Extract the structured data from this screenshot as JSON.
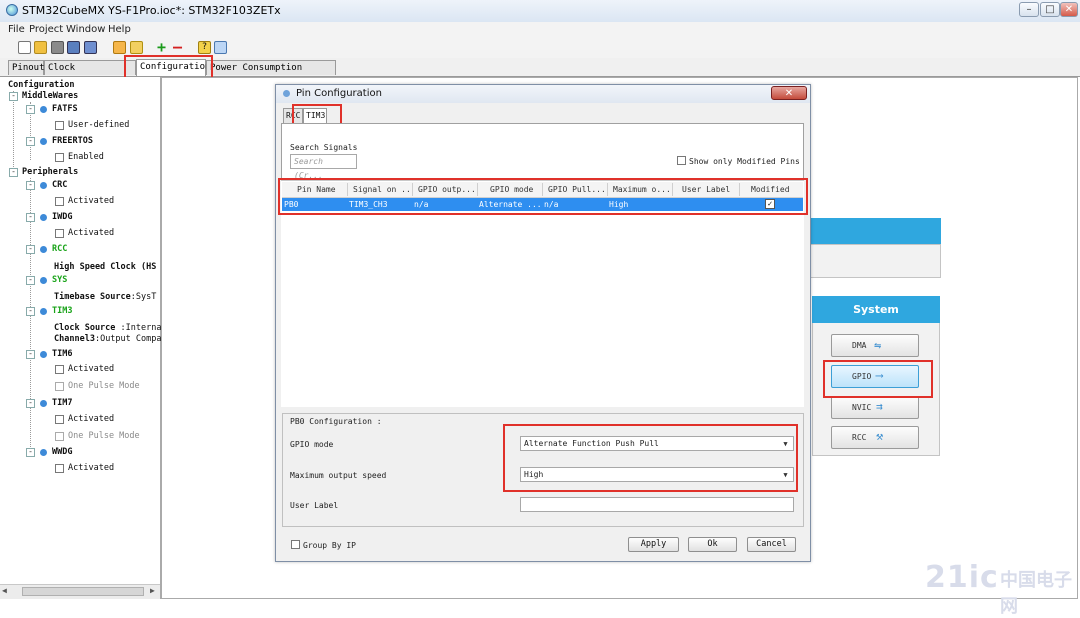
{
  "window": {
    "title": "STM32CubeMX YS-F1Pro.ioc*: STM32F103ZETx",
    "min": "–",
    "max": "□",
    "close": "✕"
  },
  "menu": [
    "File",
    "Project",
    "Window",
    "Help"
  ],
  "tabs": [
    "Pinout",
    "Clock Configuration",
    "Configuration",
    "Power Consumption Calculator"
  ],
  "tree": {
    "root": "Configuration",
    "middlewares": "MiddleWares",
    "fatfs": "FATFS",
    "fatfs_opt": "User-defined",
    "freertos": "FREERTOS",
    "freertos_opt": "Enabled",
    "peripherals": "Peripherals",
    "crc": "CRC",
    "crc_opt": "Activated",
    "iwdg": "IWDG",
    "iwdg_opt": "Activated",
    "rcc": "RCC",
    "rcc_opt": "High Speed Clock (HS",
    "sys": "SYS",
    "sys_opt": "Timebase Source",
    "sys_opt_val": ":SysT",
    "tim3": "TIM3",
    "tim3_opt1": "Clock Source",
    "tim3_opt1_val": " :Interna",
    "tim3_opt2": "Channel3",
    "tim3_opt2_val": ":Output Compar",
    "tim6": "TIM6",
    "tim6_opt1": "Activated",
    "tim6_opt2": "One Pulse Mode",
    "tim7": "TIM7",
    "tim7_opt1": "Activated",
    "tim7_opt2": "One Pulse Mode",
    "wwdg": "WWDG",
    "wwdg_opt": "Activated"
  },
  "system": {
    "header": "System",
    "buttons": [
      "DMA",
      "GPIO",
      "NVIC",
      "RCC"
    ]
  },
  "dialog": {
    "title": "Pin Configuration",
    "tabs": [
      "RCC",
      "TIM3"
    ],
    "search_label": "Search Signals",
    "search_placeholder": "Search (Cr...",
    "show_modified": "Show only Modified Pins",
    "columns": [
      "Pin Name",
      "Signal on ...",
      "GPIO outp...",
      "GPIO mode",
      "GPIO Pull...",
      "Maximum o...",
      "User Label",
      "Modified"
    ],
    "rows": [
      {
        "pin": "PB0",
        "signal": "TIM3_CH3",
        "gpio_output": "n/a",
        "gpio_mode": "Alternate ...",
        "gpio_pull": "n/a",
        "max_speed": "High",
        "user_label": "",
        "modified": "✓"
      }
    ],
    "config_title": "PB0 Configuration :",
    "gpio_mode_label": "GPIO mode",
    "gpio_mode_value": "Alternate Function Push Pull",
    "max_speed_label": "Maximum output speed",
    "max_speed_value": "High",
    "user_label_label": "User Label",
    "user_label_value": "",
    "group_by_ip": "Group By IP",
    "apply": "Apply",
    "ok": "Ok",
    "cancel": "Cancel"
  },
  "watermark": {
    "logo": "21ic",
    "text": "中国电子网"
  }
}
